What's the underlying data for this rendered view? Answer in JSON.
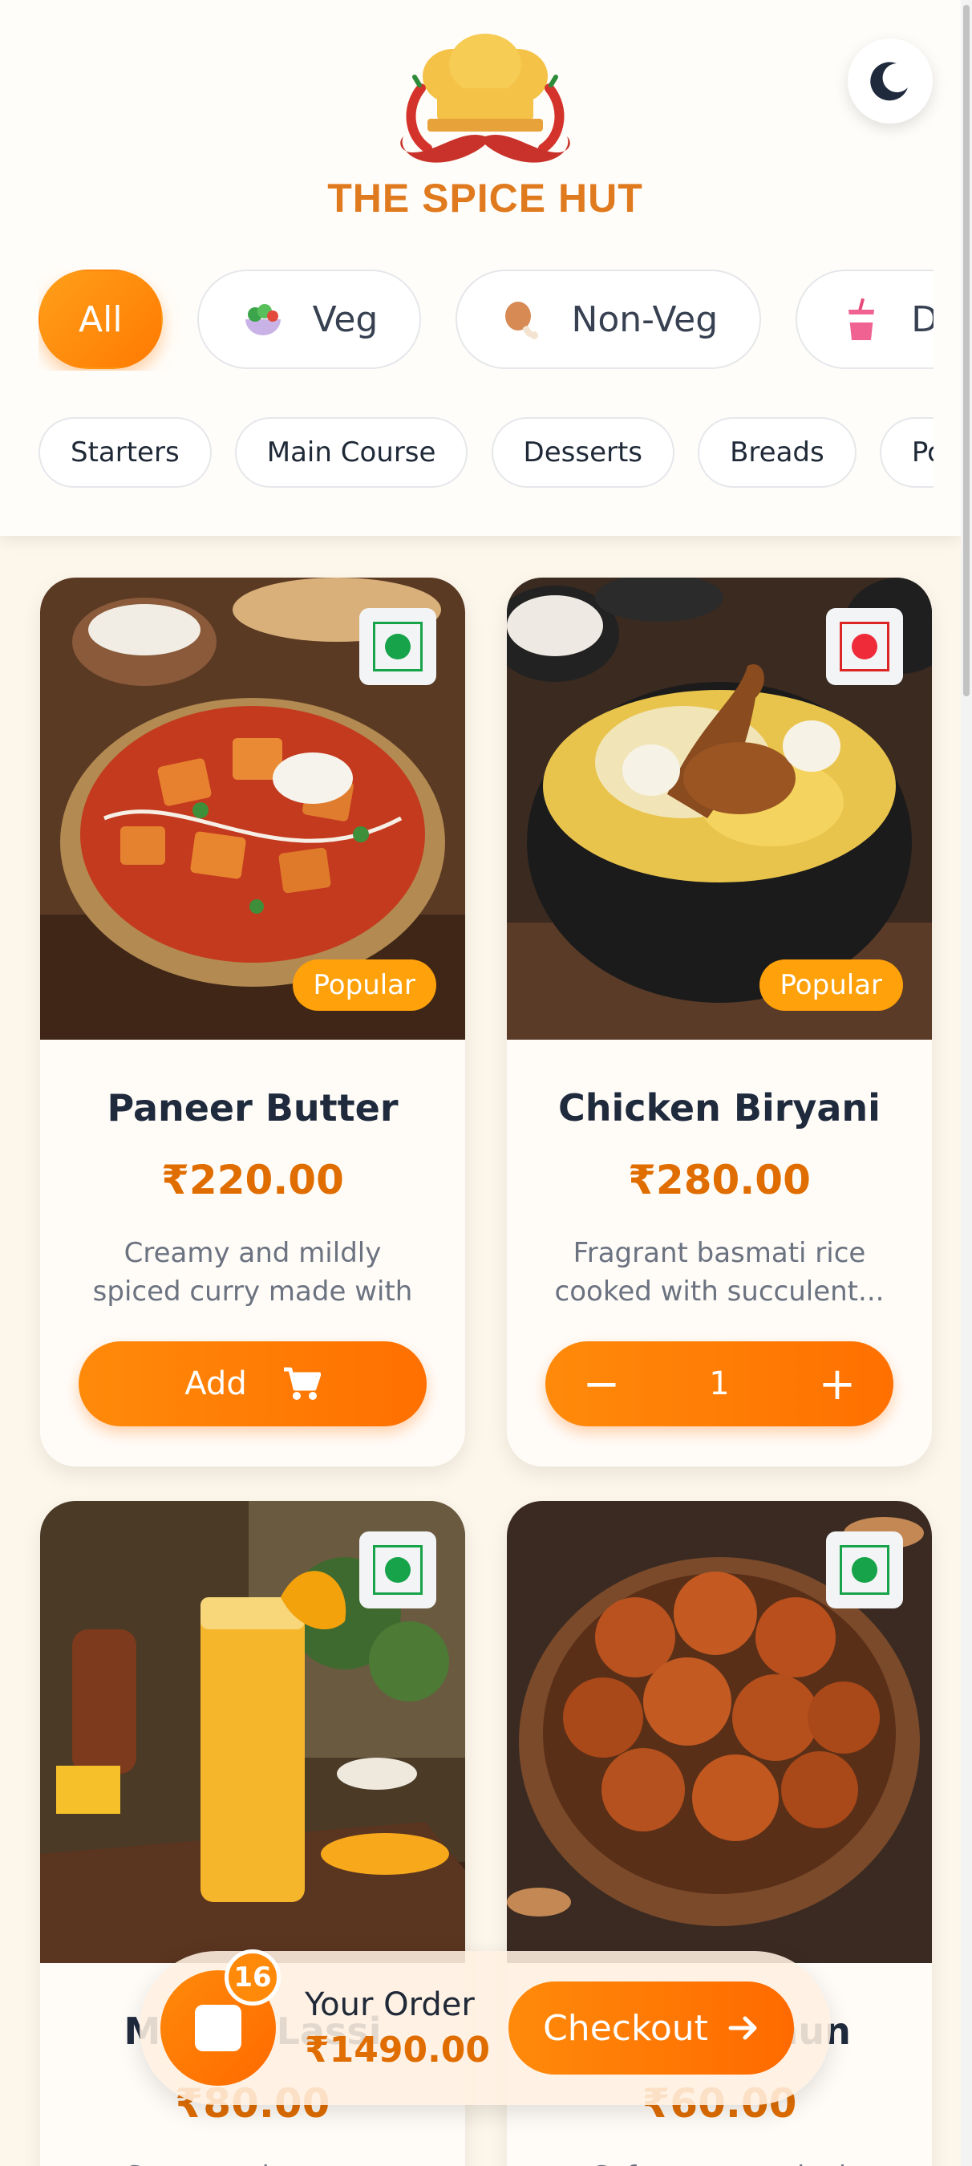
{
  "brand": {
    "name": "THE SPICE HUT"
  },
  "theme_toggle": {
    "icon": "moon-icon"
  },
  "diet_filters": [
    {
      "label": "All",
      "icon": "",
      "active": true
    },
    {
      "label": "Veg",
      "icon": "salad-icon",
      "active": false
    },
    {
      "label": "Non-Veg",
      "icon": "chicken-leg-icon",
      "active": false
    },
    {
      "label": "Dr",
      "icon": "drink-icon",
      "active": false
    }
  ],
  "categories": [
    "Starters",
    "Main Course",
    "Desserts",
    "Breads",
    "Popular"
  ],
  "items": [
    {
      "name": "Paneer Butter",
      "price": "₹220.00",
      "description": "Creamy and mildly spiced curry made with paneer...",
      "diet": "veg",
      "badge": "Popular",
      "action": "Add",
      "quantity": null
    },
    {
      "name": "Chicken Biryani",
      "price": "₹280.00",
      "description": "Fragrant basmati rice cooked with succulent...",
      "diet": "non-veg",
      "badge": "Popular",
      "quantity": "1"
    },
    {
      "name": "Mango Lassi",
      "price": "₹80.00",
      "description": "Sweet and creamy yogurt...",
      "diet": "veg"
    },
    {
      "name": "Gulab Jamun",
      "price": "₹60.00",
      "description": "Soft, syrup-soaked dough...",
      "diet": "veg"
    }
  ],
  "order_bar": {
    "count": "16",
    "label": "Your Order",
    "total": "₹1490.00",
    "checkout": "Checkout"
  },
  "colors": {
    "accent": "#ff7a00",
    "price": "#e06d00",
    "veg": "#16a34a",
    "non_veg": "#dc2626"
  }
}
